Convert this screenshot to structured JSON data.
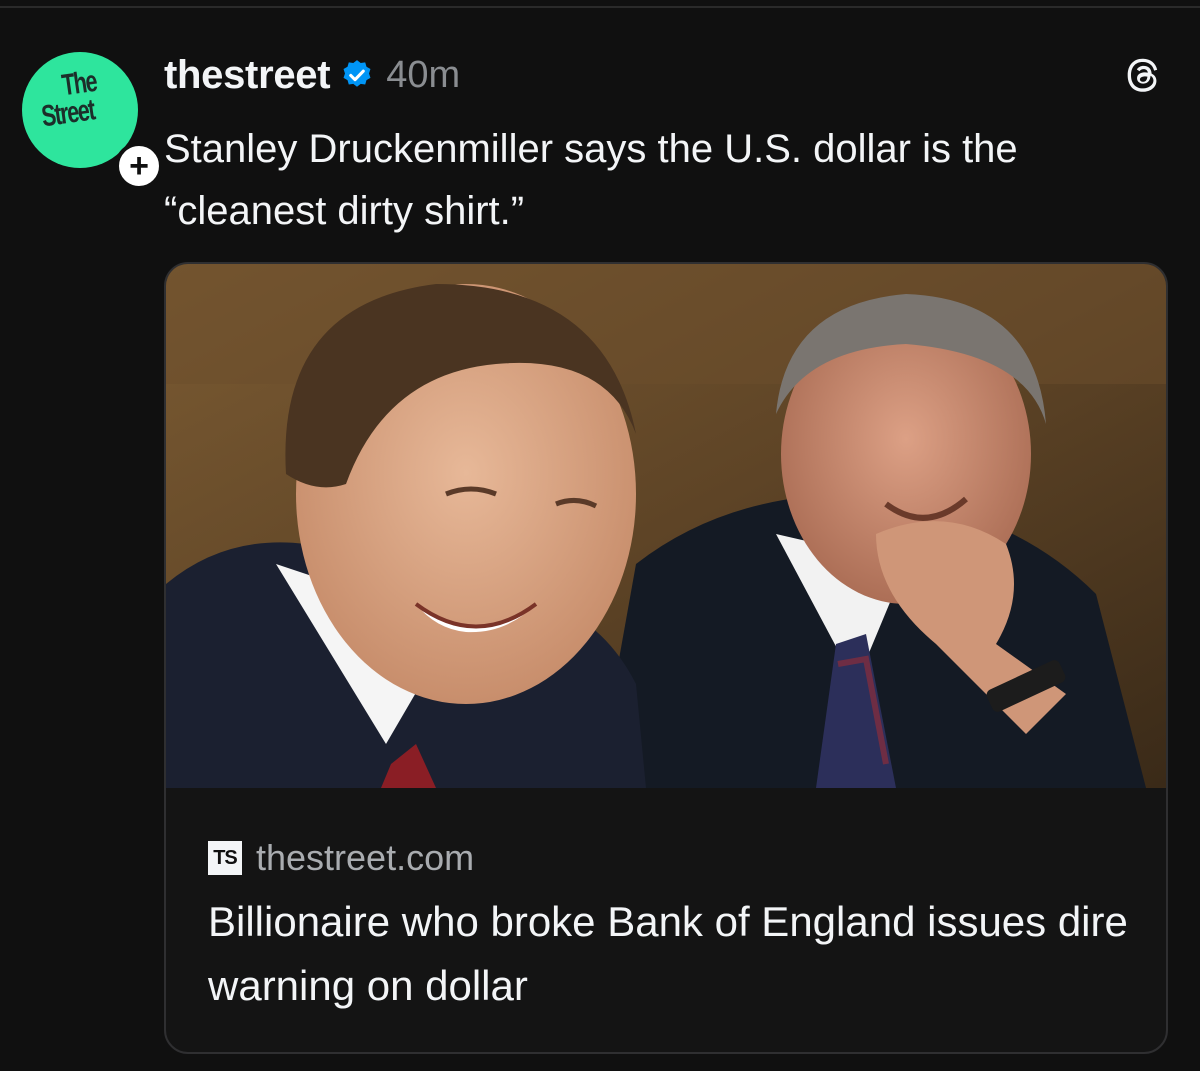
{
  "post": {
    "avatar_text_line1": "The",
    "avatar_text_line2": "Street",
    "follow_symbol": "+",
    "username": "thestreet",
    "verified": true,
    "timestamp": "40m",
    "text": "Stanley Druckenmiller says the U.S. dollar is the “cleanest dirty shirt.”"
  },
  "link_card": {
    "site_logo_text": "TS",
    "domain": "thestreet.com",
    "headline": "Billionaire who broke Bank of England issues dire warning on dollar"
  },
  "icons": {
    "threads": "threads-logo-icon",
    "verified": "verified-badge-icon",
    "follow": "plus-icon"
  },
  "colors": {
    "background": "#101010",
    "avatar": "#2ee59d",
    "verified": "#0095f6",
    "secondary_text": "#8a8d91"
  }
}
